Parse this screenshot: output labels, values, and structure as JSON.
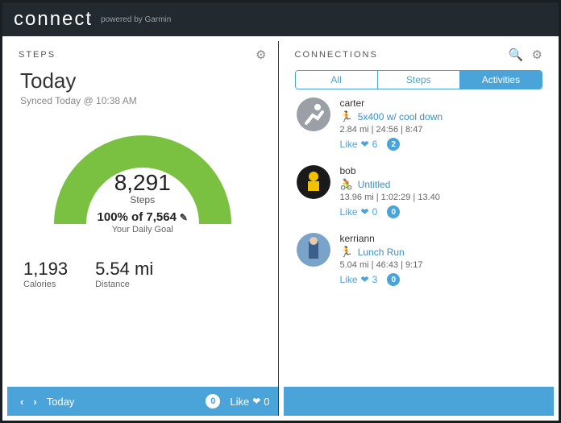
{
  "brand": {
    "name": "connect",
    "sub": "powered by Garmin"
  },
  "steps_panel": {
    "title": "STEPS",
    "today": "Today",
    "synced": "Synced Today @ 10:38 AM",
    "count": "8,291",
    "count_label": "Steps",
    "goal_line": "100% of 7,564",
    "goal_sub": "Your Daily Goal",
    "calories": {
      "value": "1,193",
      "label": "Calories"
    },
    "distance": {
      "value": "5.54 mi",
      "label": "Distance"
    },
    "footer": {
      "label": "Today",
      "comments": "0",
      "like_label": "Like",
      "likes": "0"
    }
  },
  "connections_panel": {
    "title": "CONNECTIONS",
    "tabs": {
      "all": "All",
      "steps": "Steps",
      "activities": "Activities"
    },
    "posts": [
      {
        "user": "carter",
        "activity_icon": "run",
        "activity_title": "5x400 w/ cool down",
        "meta": "2.84 mi | 24:56 | 8:47",
        "like_label": "Like",
        "likes": "6",
        "comments": "2",
        "avatar_kind": "placeholder"
      },
      {
        "user": "bob",
        "activity_icon": "bike",
        "activity_title": "Untitled",
        "meta": "13.96 mi | 1:02:29 | 13.40",
        "like_label": "Like",
        "likes": "0",
        "comments": "0",
        "avatar_kind": "bike-yellow"
      },
      {
        "user": "kerriann",
        "activity_icon": "run",
        "activity_title": "Lunch Run",
        "meta": "5.04 mi | 46:43 | 9:17",
        "like_label": "Like",
        "likes": "3",
        "comments": "0",
        "avatar_kind": "runner-photo"
      }
    ]
  },
  "chart_data": {
    "type": "gauge",
    "value": 8291,
    "goal": 7564,
    "percent": 100,
    "unit": "Steps",
    "color": "#7ac142"
  }
}
